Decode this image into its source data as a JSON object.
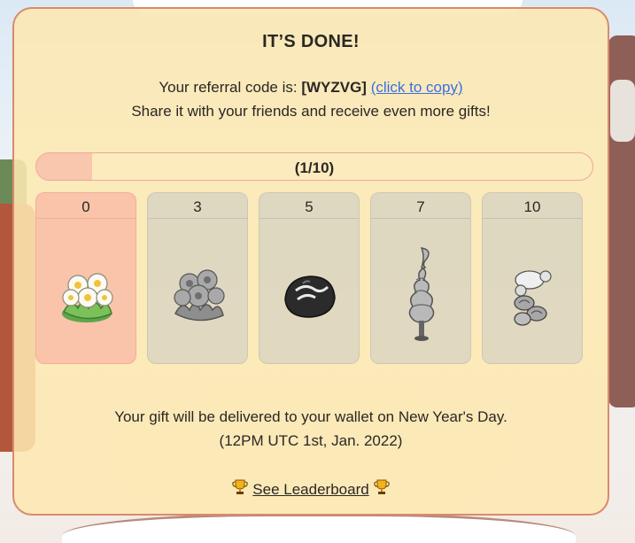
{
  "modal": {
    "title": "IT’S DONE!",
    "referral_prefix": "Your referral code is: ",
    "referral_code": "[WYZVG]",
    "copy_link": "(click to copy)",
    "share_text": "Share it with your friends and receive even more gifts!"
  },
  "progress": {
    "label": "(1/10)",
    "current": 1,
    "total": 10
  },
  "tiers": [
    {
      "threshold": "0",
      "reward_icon": "white-flowers-icon",
      "unlocked": true
    },
    {
      "threshold": "3",
      "reward_icon": "gray-flowers-icon",
      "unlocked": false
    },
    {
      "threshold": "5",
      "reward_icon": "chocolate-candy-icon",
      "unlocked": false
    },
    {
      "threshold": "7",
      "reward_icon": "swirl-tree-icon",
      "unlocked": false
    },
    {
      "threshold": "10",
      "reward_icon": "sheep-icon",
      "unlocked": false
    }
  ],
  "delivery": {
    "message": "Your gift will be delivered to your wallet on New Year's Day.",
    "time": "(12PM UTC 1st, Jan. 2022)"
  },
  "leaderboard": {
    "label": "See Leaderboard",
    "icon": "trophy-icon"
  },
  "colors": {
    "modal_bg": "#fde8b2",
    "modal_border": "#d98a6e",
    "active_tier": "#f8aaa0",
    "locked_tier": "#c8c8c4",
    "link": "#3b6fe0"
  }
}
